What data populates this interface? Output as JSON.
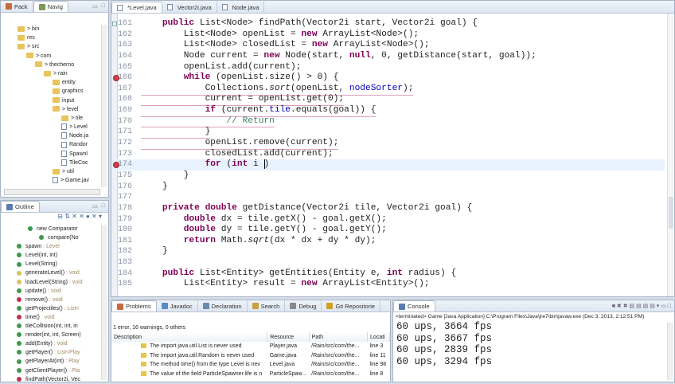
{
  "left_top": {
    "tabs": [
      "Pack",
      "Navig"
    ],
    "tree": [
      {
        "label": "> bin",
        "depth": 1,
        "kind": "folder"
      },
      {
        "label": "res",
        "depth": 1,
        "kind": "folder"
      },
      {
        "label": "> src",
        "depth": 1,
        "kind": "folder"
      },
      {
        "label": "> com",
        "depth": 2,
        "kind": "folder"
      },
      {
        "label": "> thecherno",
        "depth": 3,
        "kind": "folder"
      },
      {
        "label": "> rain",
        "depth": 4,
        "kind": "folder"
      },
      {
        "label": "entity",
        "depth": 5,
        "kind": "folder"
      },
      {
        "label": "graphics",
        "depth": 5,
        "kind": "folder"
      },
      {
        "label": "input",
        "depth": 5,
        "kind": "folder"
      },
      {
        "label": "> level",
        "depth": 5,
        "kind": "folder"
      },
      {
        "label": "> tile",
        "depth": 6,
        "kind": "folder"
      },
      {
        "label": "> Level",
        "depth": 6,
        "kind": "file"
      },
      {
        "label": "Node.ja",
        "depth": 6,
        "kind": "file"
      },
      {
        "label": "Randor",
        "depth": 6,
        "kind": "file"
      },
      {
        "label": "Spawnl",
        "depth": 6,
        "kind": "file"
      },
      {
        "label": "TileCoc",
        "depth": 6,
        "kind": "file"
      },
      {
        "label": "> util",
        "depth": 5,
        "kind": "folder"
      },
      {
        "label": "> Game.jav",
        "depth": 5,
        "kind": "file"
      }
    ]
  },
  "outline": {
    "title": "Outline",
    "items": [
      {
        "name": "new Comparator",
        "ret": "",
        "depth": 1,
        "color": "#3c9a4a"
      },
      {
        "name": "compare(No",
        "ret": "",
        "depth": 2,
        "color": "#3c9a4a"
      },
      {
        "name": "spawn",
        "ret": " : Level",
        "depth": 0,
        "color": "#3c9a4a"
      },
      {
        "name": "Level(int, int)",
        "ret": "",
        "depth": 0,
        "color": "#3c9a4a"
      },
      {
        "name": "Level(String)",
        "ret": "",
        "depth": 0,
        "color": "#3c9a4a"
      },
      {
        "name": "generateLevel()",
        "ret": " : void",
        "depth": 0,
        "color": "#d8c060"
      },
      {
        "name": "loadLevel(String)",
        "ret": " : void",
        "depth": 0,
        "color": "#d8c060"
      },
      {
        "name": "update()",
        "ret": " : void",
        "depth": 0,
        "color": "#3c9a4a"
      },
      {
        "name": "remove()",
        "ret": " : void",
        "depth": 0,
        "color": "#c03050"
      },
      {
        "name": "getProjectiles()",
        "ret": " : List<",
        "depth": 0,
        "color": "#3c9a4a"
      },
      {
        "name": "time()",
        "ret": " : void",
        "depth": 0,
        "color": "#c03050"
      },
      {
        "name": "tileCollision(int, int, in",
        "ret": "",
        "depth": 0,
        "color": "#3c9a4a"
      },
      {
        "name": "render(int, int, Screen)",
        "ret": "",
        "depth": 0,
        "color": "#3c9a4a"
      },
      {
        "name": "add(Entity)",
        "ret": " : void",
        "depth": 0,
        "color": "#3c9a4a"
      },
      {
        "name": "getPlayer()",
        "ret": " : List<Play",
        "depth": 0,
        "color": "#3c9a4a"
      },
      {
        "name": "getPlayerAt(int)",
        "ret": " : Play",
        "depth": 0,
        "color": "#3c9a4a"
      },
      {
        "name": "getClientPlayer()",
        "ret": " : Pla",
        "depth": 0,
        "color": "#3c9a4a"
      },
      {
        "name": "findPath(Vector2i, Vec",
        "ret": "",
        "depth": 0,
        "color": "#c03050"
      }
    ]
  },
  "editor": {
    "tabs": [
      "*Level.java",
      "Vector2i.java",
      "Node.java"
    ],
    "current_line": 174,
    "lines": [
      {
        "n": 161,
        "mark": "fold",
        "t": [
          [
            "",
            "    "
          ],
          [
            "kw",
            "public"
          ],
          [
            "",
            " List<Node> findPath(Vector2i start, Vector2i goal) {"
          ]
        ]
      },
      {
        "n": 162,
        "t": [
          [
            "",
            "        List<Node> openList = "
          ],
          [
            "kw",
            "new"
          ],
          [
            "",
            " ArrayList<Node>();"
          ]
        ]
      },
      {
        "n": 163,
        "t": [
          [
            "",
            "        List<Node> closedList = "
          ],
          [
            "kw",
            "new"
          ],
          [
            "",
            " ArrayList<Node>();"
          ]
        ]
      },
      {
        "n": 164,
        "t": [
          [
            "",
            "        Node current = "
          ],
          [
            "kw",
            "new"
          ],
          [
            "",
            " Node(start, "
          ],
          [
            "kw",
            "null"
          ],
          [
            "",
            ", 0, getDistance(start, goal));"
          ]
        ]
      },
      {
        "n": 165,
        "t": [
          [
            "",
            "        openList.add(current);"
          ]
        ]
      },
      {
        "n": 166,
        "mark": "error",
        "t": [
          [
            "",
            "        "
          ],
          [
            "kw",
            "while"
          ],
          [
            "",
            " (openList.size() > 0) {"
          ]
        ]
      },
      {
        "n": 167,
        "err": true,
        "t": [
          [
            "",
            "            Collections."
          ],
          [
            "it",
            "sort"
          ],
          [
            "",
            "(openList, "
          ],
          [
            "fld",
            "nodeSorter"
          ],
          [
            "",
            ");"
          ]
        ]
      },
      {
        "n": 168,
        "err": true,
        "t": [
          [
            "",
            "            current = openList.get(0);"
          ]
        ]
      },
      {
        "n": 169,
        "err": true,
        "t": [
          [
            "",
            "            "
          ],
          [
            "kw",
            "if"
          ],
          [
            "",
            " (current."
          ],
          [
            "fld",
            "tile"
          ],
          [
            "",
            ".equals(goal)) {"
          ]
        ]
      },
      {
        "n": 170,
        "err": true,
        "t": [
          [
            "cmt",
            "                // Return"
          ]
        ]
      },
      {
        "n": 171,
        "err": true,
        "t": [
          [
            "",
            "            }"
          ]
        ]
      },
      {
        "n": 172,
        "err": true,
        "t": [
          [
            "",
            "            openList.remove(current);"
          ]
        ]
      },
      {
        "n": 173,
        "err": true,
        "t": [
          [
            "",
            "            closedList.add(current);"
          ]
        ]
      },
      {
        "n": 174,
        "mark": "error",
        "t": [
          [
            "",
            "            "
          ],
          [
            "kw",
            "for"
          ],
          [
            "",
            " ("
          ],
          [
            "kw",
            "int"
          ],
          [
            "",
            " i )"
          ]
        ]
      },
      {
        "n": 175,
        "t": [
          [
            "",
            "        }"
          ]
        ]
      },
      {
        "n": 176,
        "t": [
          [
            "",
            "    }"
          ]
        ]
      },
      {
        "n": 177,
        "t": []
      },
      {
        "n": 178,
        "t": [
          [
            "",
            "    "
          ],
          [
            "kw",
            "private double"
          ],
          [
            "",
            " getDistance(Vector2i tile, Vector2i goal) {"
          ]
        ]
      },
      {
        "n": 179,
        "t": [
          [
            "",
            "        "
          ],
          [
            "kw",
            "double"
          ],
          [
            "",
            " dx = tile.getX() - goal.getX();"
          ]
        ]
      },
      {
        "n": 180,
        "t": [
          [
            "",
            "        "
          ],
          [
            "kw",
            "double"
          ],
          [
            "",
            " dy = tile.getY() - goal.getY();"
          ]
        ]
      },
      {
        "n": 181,
        "t": [
          [
            "",
            "        "
          ],
          [
            "kw",
            "return"
          ],
          [
            "",
            " Math."
          ],
          [
            "it",
            "sqrt"
          ],
          [
            "",
            "(dx * dx + dy * dy);"
          ]
        ]
      },
      {
        "n": 182,
        "t": [
          [
            "",
            "    }"
          ]
        ]
      },
      {
        "n": 183,
        "t": []
      },
      {
        "n": 184,
        "t": [
          [
            "",
            "    "
          ],
          [
            "kw",
            "public"
          ],
          [
            "",
            " List<Entity> getEntities(Entity e, "
          ],
          [
            "kw",
            "int"
          ],
          [
            "",
            " radius) {"
          ]
        ]
      },
      {
        "n": 185,
        "t": [
          [
            "",
            "        List<Entity> result = "
          ],
          [
            "kw",
            "new"
          ],
          [
            "",
            " ArrayList<Entity>();"
          ]
        ]
      }
    ]
  },
  "problems": {
    "tabs": [
      "Problems",
      "Javadoc",
      "Declaration",
      "Search",
      "Debug",
      "Git Repositorie"
    ],
    "summary": "1 error, 16 warnings, 0 others",
    "columns": [
      "Description",
      "Resource",
      "Path",
      "Locati"
    ],
    "rows": [
      [
        "The import java.util.List is never used",
        "Player.java",
        "/Rain/src/com/the...",
        "line 3"
      ],
      [
        "The import java.util.Random is never used",
        "Game.java",
        "/Rain/src/com/the...",
        "line 11"
      ],
      [
        "The method time() from the type Level is nev",
        "Level.java",
        "/Rain/src/com/the...",
        "line 98"
      ],
      [
        "The value of the field ParticleSpawner.life is n",
        "ParticleSpaw...",
        "/Rain/src/com/the...",
        "line 8"
      ]
    ]
  },
  "console": {
    "title": "Console",
    "status": "<terminated> Game [Java Application] C:\\Program Files\\Java\\jre7\\bin\\javaw.exe (Dec 3, 2013, 2:12:51 PM)",
    "lines": [
      "60 ups, 3664 fps",
      "60 ups, 3667 fps",
      "60 ups, 2839 fps",
      "60 ups, 3294 fps"
    ]
  }
}
